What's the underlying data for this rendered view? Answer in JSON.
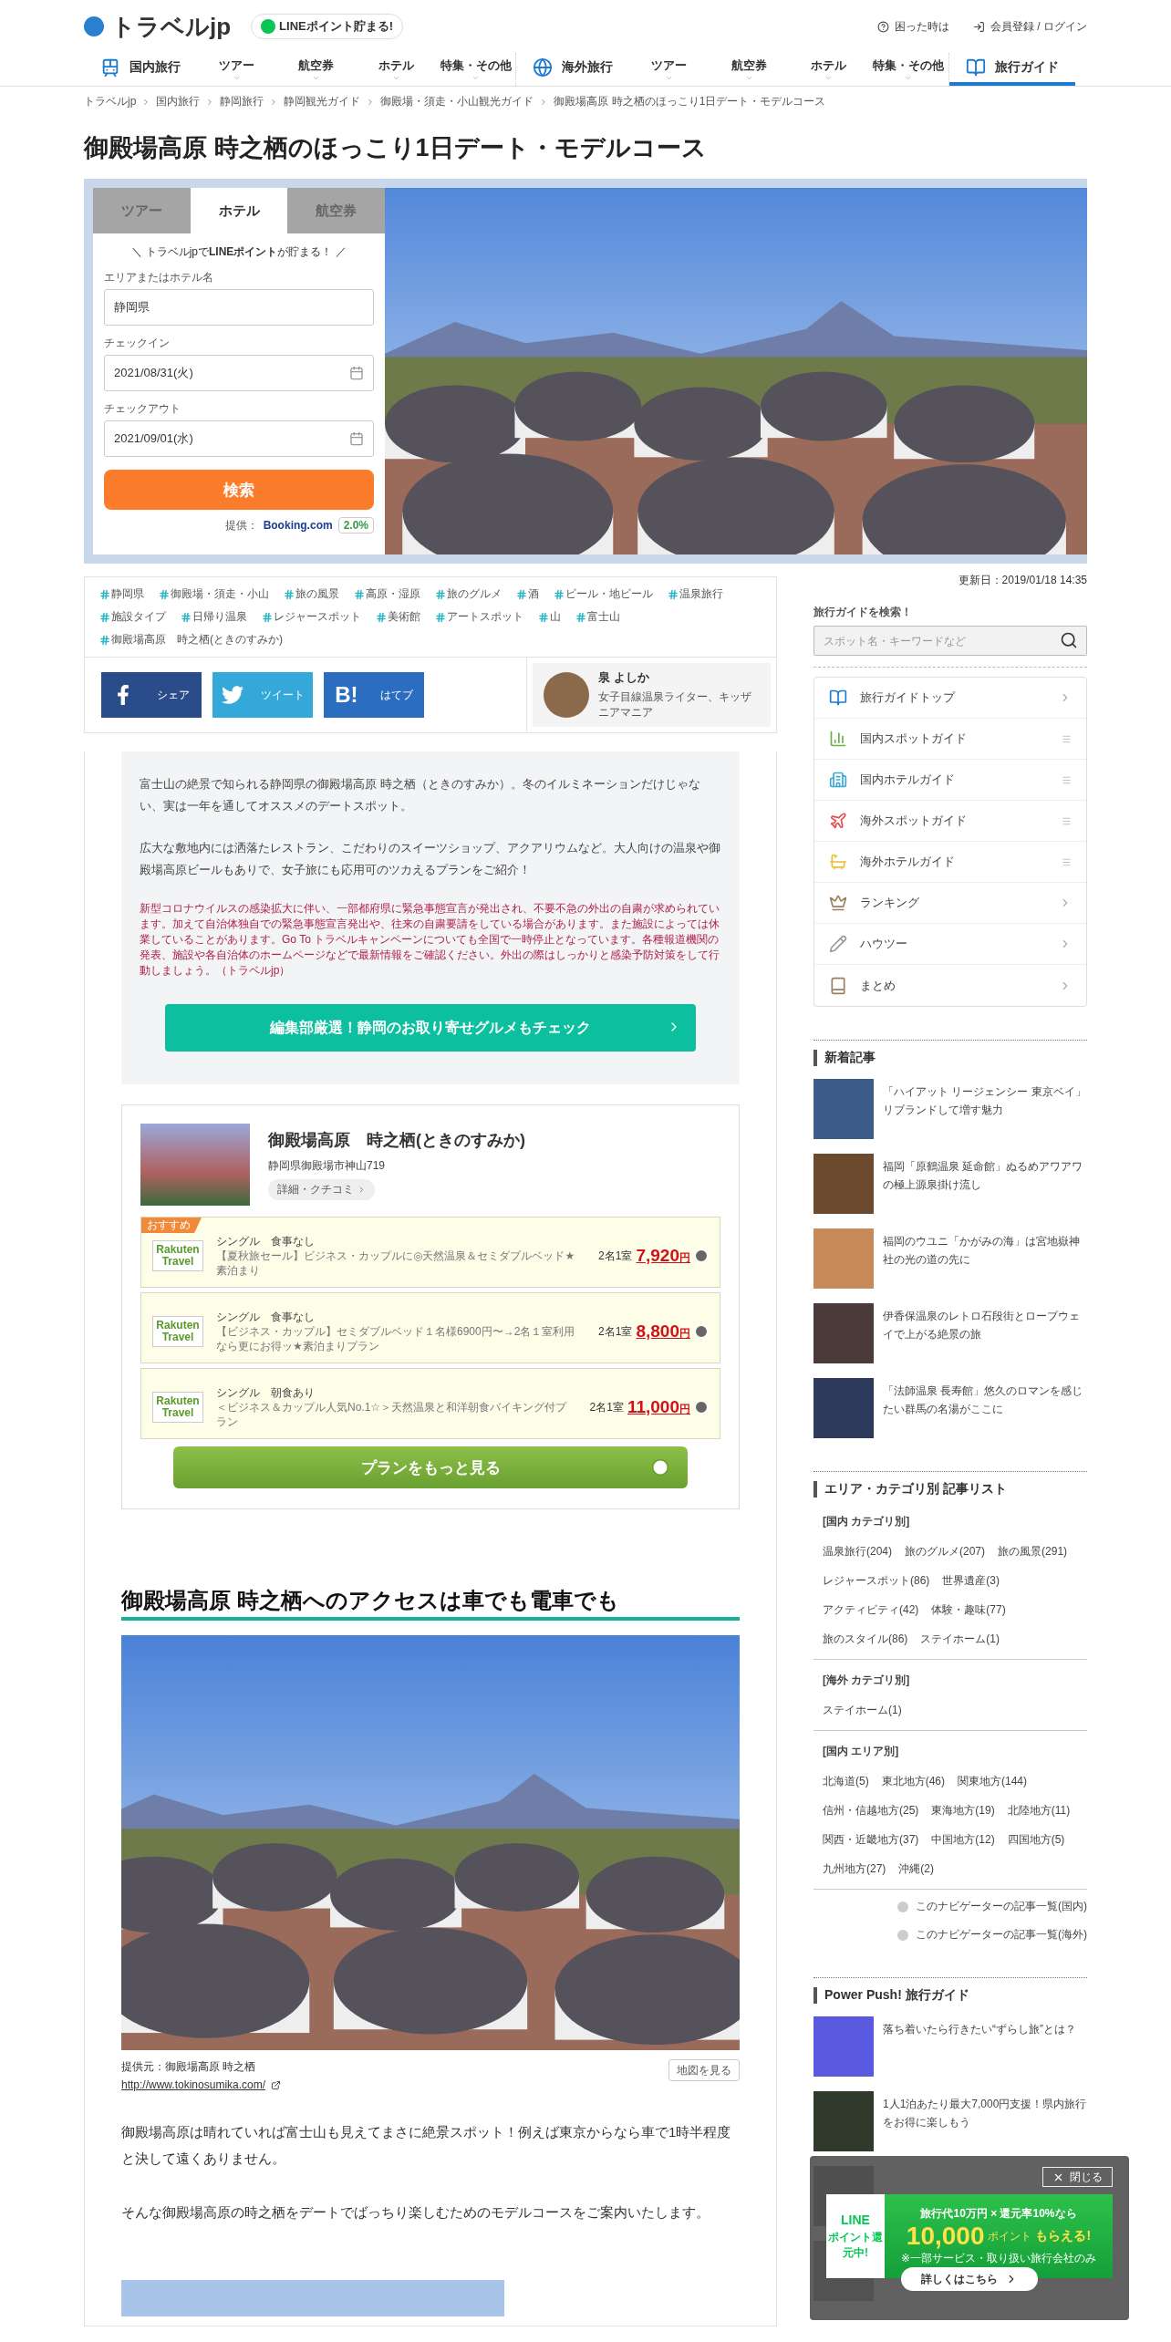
{
  "header": {
    "logo": "トラベルjp",
    "line_badge": "LINEポイント貯まる!",
    "links": [
      {
        "kind": "help",
        "label": "困った時は"
      },
      {
        "kind": "login",
        "label": "会員登録 / ログイン"
      }
    ]
  },
  "nav": [
    {
      "kind": "domestic",
      "title": "国内旅行",
      "selected": false,
      "items": [
        "ツアー",
        "航空券",
        "ホテル",
        "特集・その他"
      ]
    },
    {
      "kind": "overseas",
      "title": "海外旅行",
      "selected": false,
      "items": [
        "ツアー",
        "航空券",
        "ホテル",
        "特集・その他"
      ]
    },
    {
      "kind": "guide",
      "title": "旅行ガイド",
      "selected": true
    }
  ],
  "breadcrumb": [
    "トラベルjp",
    "国内旅行",
    "静岡旅行",
    "静岡観光ガイド",
    "御殿場・須走・小山観光ガイド",
    "御殿場高原 時之栖のほっこり1日デート・モデルコース"
  ],
  "title": "御殿場高原 時之栖のほっこり1日デート・モデルコース",
  "booking": {
    "tabs": [
      {
        "label": "ツアー",
        "selected": false
      },
      {
        "label": "ホテル",
        "selected": true
      },
      {
        "label": "航空券",
        "selected": false
      }
    ],
    "promo": "＼ トラベルjpで**LINEポイント**が貯まる！ ／",
    "fields": [
      {
        "kind": "text",
        "label": "エリアまたはホテル名",
        "value": "静岡県"
      },
      {
        "kind": "date",
        "label": "チェックイン",
        "value": "2021/08/31(火)"
      },
      {
        "kind": "date",
        "label": "チェックアウト",
        "value": "2021/09/01(水)"
      }
    ],
    "button": "検索",
    "provider_label": "提供：",
    "provider": "Booking.com",
    "points": "2.0%"
  },
  "updated": "更新日：2019/01/18 14:35",
  "tags": [
    "静岡県",
    "御殿場・須走・小山",
    "旅の風景",
    "高原・湿原",
    "旅のグルメ",
    "酒",
    "ビール・地ビール",
    "温泉旅行",
    "施設タイプ",
    "日帰り温泉",
    "レジャースポット",
    "美術館",
    "アートスポット",
    "山",
    "富士山",
    "御殿場高原　時之栖(ときのすみか)"
  ],
  "share": [
    {
      "kind": "facebook",
      "label": "シェア"
    },
    {
      "kind": "twitter",
      "label": "ツイート"
    },
    {
      "kind": "hatena",
      "mark": "B!",
      "label": "はてブ"
    }
  ],
  "author": {
    "name": "泉 よしか",
    "bio": "女子目線温泉ライター、キッザニアマニア"
  },
  "intro": {
    "paragraphs": [
      "富士山の絶景で知られる静岡県の御殿場高原 時之栖（ときのすみか）。冬のイルミネーションだけじゃない、実は一年を通してオススメのデートスポット。",
      "広大な敷地内には洒落たレストラン、こだわりのスイーツショップ、アクアリウムなど。大人向けの温泉や御殿場高原ビールもありで、女子旅にも応用可のツカえるプランをご紹介！"
    ],
    "notice": "新型コロナウイルスの感染拡大に伴い、一部都府県に緊急事態宣言が発出され、不要不急の外出の自粛が求められています。加えて自治体独自での緊急事態宣言発出や、往来の自粛要請をしている場合があります。また施設によっては休業していることがあります。Go To トラベルキャンペーンについても全国で一時停止となっています。各種報道機関の発表、施設や各自治体のホームページなどで最新情報をご確認ください。外出の際はしっかりと感染予防対策をして行動しましょう。（トラベルjp）",
    "cta": "編集部厳選！静岡のお取り寄せグルメもチェック"
  },
  "hotel": {
    "name": "御殿場高原　時之栖(ときのすみか)",
    "address": "静岡県御殿場市神山719",
    "detail_link": "詳細・クチコミ",
    "plans": [
      {
        "badge": "おすすめ",
        "provider": "Rakuten Travel",
        "room": "シングル　食事なし",
        "description": "【夏秋旅セール】ビジネス・カップルに◎天然温泉＆セミダブルベッド★素泊まり",
        "occupancy": "2名1室",
        "price": "7,920",
        "currency": "円"
      },
      {
        "provider": "Rakuten Travel",
        "room": "シングル　食事なし",
        "description": "【ビジネス・カップル】セミダブルベッド１名様6900円〜→2名１室利用なら更にお得ッ★素泊まりプラン",
        "occupancy": "2名1室",
        "price": "8,800",
        "currency": "円"
      },
      {
        "provider": "Rakuten Travel",
        "room": "シングル　朝食あり",
        "description": "＜ビジネス＆カップル人気No.1☆＞天然温泉と和洋朝食バイキング付プラン",
        "occupancy": "2名1室",
        "price": "11,000",
        "currency": "円"
      }
    ],
    "more_button": "プランをもっと見る"
  },
  "section": {
    "heading": "御殿場高原 時之栖へのアクセスは車でも電車でも",
    "credit": "提供元：御殿場高原 時之栖",
    "url": "http://www.tokinosumika.com/",
    "map_button": "地図を見る",
    "paragraphs": [
      "御殿場高原は晴れていれば富士山も見えてまさに絶景スポット！例えば東京からなら車で1時半程度と決して遠くありません。",
      "そんな御殿場高原の時之栖をデートでばっちり楽しむためのモデルコースをご案内いたします。"
    ]
  },
  "sidebar": {
    "search_label": "旅行ガイドを検索！",
    "search_placeholder": "スポット名・キーワードなど",
    "menu": [
      {
        "kind": "book",
        "label": "旅行ガイドトップ",
        "expandable": false
      },
      {
        "kind": "chart",
        "label": "国内スポットガイド",
        "expandable": true
      },
      {
        "kind": "building",
        "label": "国内ホテルガイド",
        "expandable": true
      },
      {
        "kind": "plane",
        "label": "海外スポットガイド",
        "expandable": true
      },
      {
        "kind": "bath",
        "label": "海外ホテルガイド",
        "expandable": true
      },
      {
        "kind": "crown",
        "label": "ランキング",
        "expandable": false
      },
      {
        "kind": "pencil",
        "label": "ハウツー",
        "expandable": false
      },
      {
        "kind": "notebook",
        "label": "まとめ",
        "expandable": false
      }
    ],
    "new_title": "新着記事",
    "new_articles": [
      {
        "title": "「ハイアット リージェンシー 東京ベイ」リブランドして増す魅力",
        "color": "#3d5c8a"
      },
      {
        "title": "福岡「原鶴温泉 延命館」ぬるめアワアワの極上源泉掛け流し",
        "color": "#6b4a2e"
      },
      {
        "title": "福岡のウユニ「かがみの海」は宮地嶽神社の光の道の先に",
        "color": "#c98a5a"
      },
      {
        "title": "伊香保温泉のレトロ石段街とロープウェイで上がる絶景の旅",
        "color": "#4a3a3a"
      },
      {
        "title": "「法師温泉 長寿館」悠久のロマンを感じたい群馬の名湯がここに",
        "color": "#2d3a5c"
      }
    ],
    "list_title": "エリア・カテゴリ別 記事リスト",
    "groups": [
      {
        "heading": "[国内 カテゴリ別]",
        "items": [
          "温泉旅行(204)",
          "旅のグルメ(207)",
          "旅の風景(291)",
          "レジャースポット(86)",
          "世界遺産(3)",
          "アクティビティ(42)",
          "体験・趣味(77)",
          "旅のスタイル(86)",
          "ステイホーム(1)"
        ]
      },
      {
        "heading": "[海外 カテゴリ別]",
        "items": [
          "ステイホーム(1)"
        ]
      },
      {
        "heading": "[国内 エリア別]",
        "items": [
          "北海道(5)",
          "東北地方(46)",
          "関東地方(144)",
          "信州・信越地方(25)",
          "東海地方(19)",
          "北陸地方(11)",
          "関西・近畿地方(37)",
          "中国地方(12)",
          "四国地方(5)",
          "九州地方(27)",
          "沖縄(2)"
        ]
      }
    ],
    "navigator_links": [
      "このナビゲーターの記事一覧(国内)",
      "このナビゲーターの記事一覧(海外)"
    ],
    "push_title": "Power Push! 旅行ガイド",
    "push_articles": [
      {
        "title": "落ち着いたら行きたい“ずらし旅”とは？",
        "color": "#5a5ae0"
      },
      {
        "title": "1人1泊あたり最大7,000円支援！県内旅行をお得に楽しもう",
        "color": "#2f3a2a"
      }
    ]
  },
  "popup": {
    "close": "閉じる",
    "line": "LINE",
    "line_sub": "ポイント還元中!",
    "headline": "旅行代10万円 × 還元率10%なら",
    "amount": "10,000",
    "unit": "ポイント",
    "get": "もらえる!",
    "note": "※一部サービス・取り扱い旅行会社のみ",
    "button": "詳しくはこちら"
  }
}
